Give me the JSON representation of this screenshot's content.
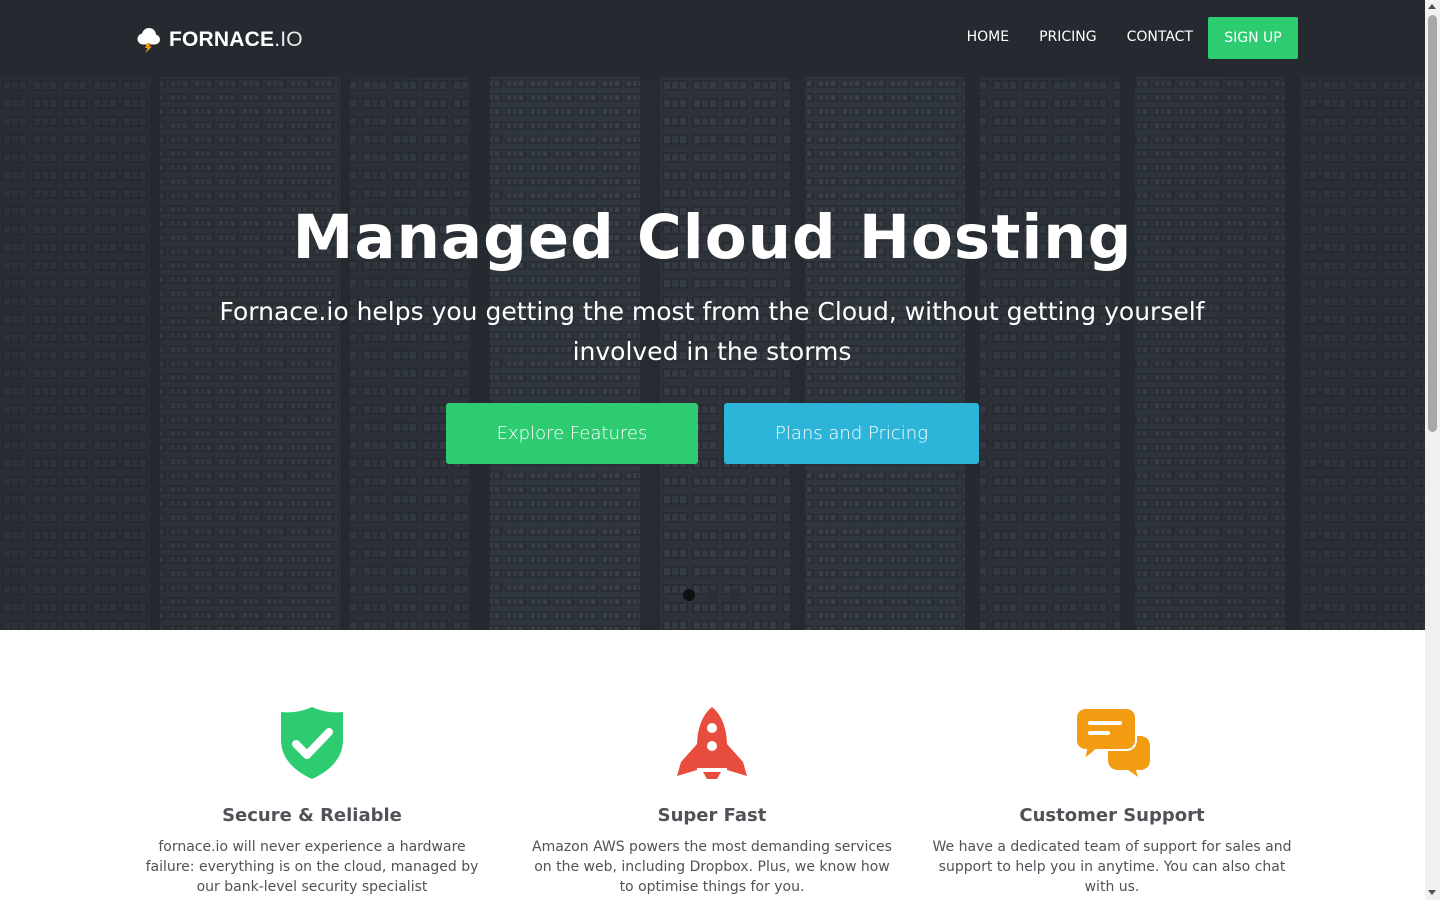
{
  "brand": {
    "name_bold": "FORNACE",
    "name_light": ".IO",
    "icon": "cloud-lightning-icon"
  },
  "nav": {
    "home": "HOME",
    "pricing": "PRICING",
    "contact": "CONTACT",
    "signup": "SIGN UP"
  },
  "hero": {
    "title": "Managed Cloud Hosting",
    "subtitle": "Fornace.io helps you getting the most from the Cloud, without getting yourself involved in the storms",
    "primary_button": "Explore Features",
    "secondary_button": "Plans and Pricing",
    "slides": 3,
    "active_slide": 1
  },
  "features": [
    {
      "icon": "shield-check-icon",
      "title": "Secure & Reliable",
      "text": "fornace.io will never experience a hardware failure: everything is on the cloud, managed by our bank-level security specialist"
    },
    {
      "icon": "rocket-icon",
      "title": "Super Fast",
      "text": "Amazon AWS powers the most demanding services on the web, including Dropbox. Plus, we know how to optimise things for you."
    },
    {
      "icon": "chat-bubbles-icon",
      "title": "Customer Support",
      "text": "We have a dedicated team of support for sales and support to help you in anytime. You can also chat with us."
    }
  ],
  "colors": {
    "navbar": "#252a31",
    "green": "#2ecc71",
    "blue": "#2cb5d8",
    "shield": "#2ecc71",
    "rocket": "#e74c3c",
    "chat": "#f39c12",
    "text": "#4f5257"
  }
}
